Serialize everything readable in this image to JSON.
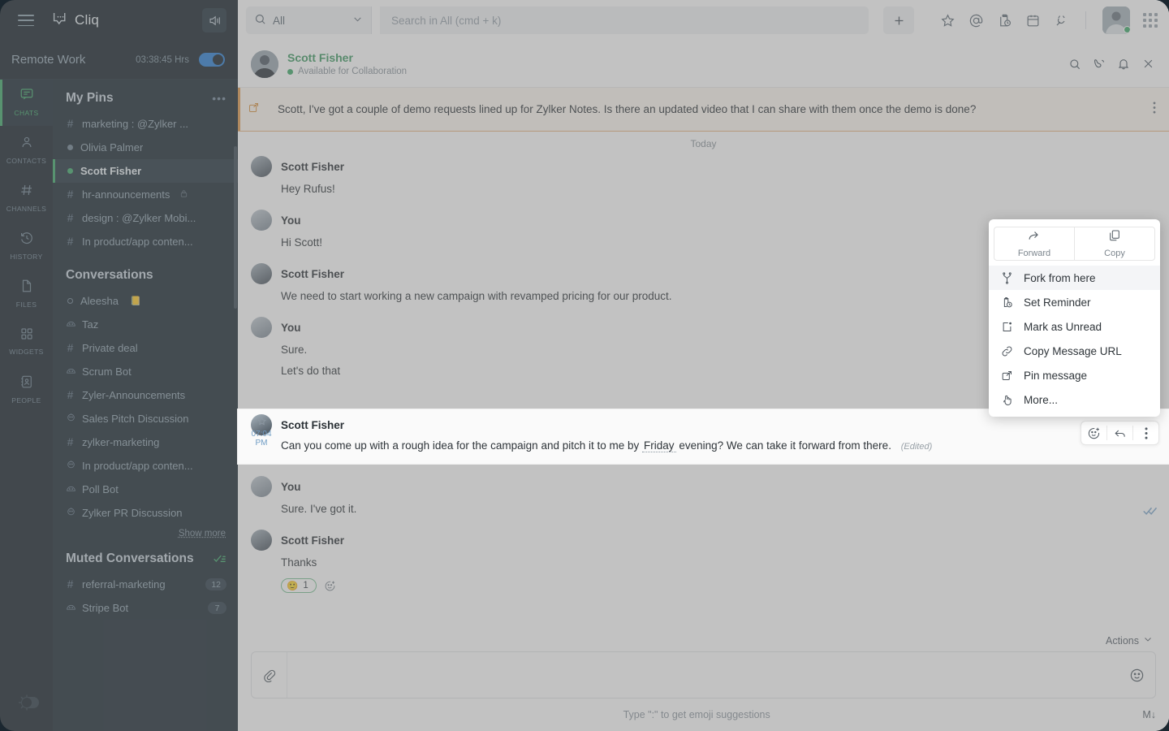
{
  "app": {
    "brand": "Cliq",
    "menu_icon": "hamburger-icon",
    "speaker_icon": "speaker-volume-icon",
    "theme_toggle_icon": "sun-theme-toggle"
  },
  "status": {
    "name": "Remote Work",
    "timer": "03:38:45 Hrs",
    "toggle_on": true
  },
  "rail": [
    {
      "label": "CHATS",
      "icon": "chat-bubble-icon",
      "active": true
    },
    {
      "label": "CONTACTS",
      "icon": "person-icon",
      "active": false
    },
    {
      "label": "CHANNELS",
      "icon": "hash-icon",
      "active": false
    },
    {
      "label": "HISTORY",
      "icon": "clock-rewind-icon",
      "active": false
    },
    {
      "label": "FILES",
      "icon": "file-icon",
      "active": false
    },
    {
      "label": "WIDGETS",
      "icon": "grid-squares-icon",
      "active": false
    },
    {
      "label": "PEOPLE",
      "icon": "contact-card-icon",
      "active": false
    }
  ],
  "sidebar": {
    "pins_title": "My Pins",
    "pins_more": "•••",
    "pins": [
      {
        "label": "marketing : @Zylker ...",
        "marker": "hash",
        "locked": false
      },
      {
        "label": "Olivia Palmer",
        "marker": "dot-grey",
        "locked": false
      },
      {
        "label": "Scott Fisher",
        "marker": "dot-green",
        "locked": false,
        "selected": true
      },
      {
        "label": "hr-announcements",
        "marker": "hash",
        "locked": true
      },
      {
        "label": "design : @Zylker Mobi...",
        "marker": "hash",
        "locked": false
      },
      {
        "label": "In product/app conten...",
        "marker": "hash",
        "locked": false
      }
    ],
    "conversations_title": "Conversations",
    "conversations": [
      {
        "label": "Aleesha",
        "marker": "dot-hollow",
        "emoji": "📒"
      },
      {
        "label": "Taz",
        "marker": "bot"
      },
      {
        "label": "Private deal",
        "marker": "hash"
      },
      {
        "label": "Scrum Bot",
        "marker": "bot"
      },
      {
        "label": "Zyler-Announcements",
        "marker": "hash"
      },
      {
        "label": "Sales Pitch Discussion",
        "marker": "group"
      },
      {
        "label": "zylker-marketing",
        "marker": "hash"
      },
      {
        "label": "In product/app conten...",
        "marker": "group"
      },
      {
        "label": "Poll Bot",
        "marker": "bot"
      },
      {
        "label": "Zylker PR Discussion",
        "marker": "group"
      }
    ],
    "show_more": "Show more",
    "muted_title": "Muted Conversations",
    "muted_action_icon": "mark-all-read-icon",
    "muted": [
      {
        "label": "referral-marketing",
        "marker": "hash",
        "count": "12"
      },
      {
        "label": "Stripe Bot",
        "marker": "bot",
        "count": "7"
      }
    ]
  },
  "search": {
    "scope_label": "All",
    "scope_icon": "search-icon",
    "placeholder": "Search in All (cmd + k)",
    "new_chat_icon": "plus-icon"
  },
  "header_icons": [
    {
      "name": "star-icon"
    },
    {
      "name": "mention-icon"
    },
    {
      "name": "reminders-icon"
    },
    {
      "name": "calendar-icon"
    },
    {
      "name": "integrations-plug-icon"
    },
    {
      "name": "apps-grid-icon"
    }
  ],
  "chat": {
    "name": "Scott Fisher",
    "status": "Available for Collaboration",
    "actions": [
      {
        "name": "search-in-chat-icon"
      },
      {
        "name": "call-icon"
      },
      {
        "name": "notification-bell-icon"
      },
      {
        "name": "close-icon"
      }
    ]
  },
  "pinned": {
    "icon": "pin-message-icon",
    "text": "Scott, I've got a couple of demo requests lined up for Zylker Notes. Is there an updated video that I can share with them once the demo is done?",
    "more_icon": "kebab-menu-icon"
  },
  "day_divider": "Today",
  "messages": [
    {
      "sender": "Scott Fisher",
      "avatar": "scott",
      "lines": [
        "Hey Rufus!"
      ]
    },
    {
      "sender": "You",
      "avatar": "you",
      "lines": [
        "Hi Scott!"
      ]
    },
    {
      "sender": "Scott Fisher",
      "avatar": "scott",
      "lines": [
        "We need to start working a new campaign with revamped pricing for our product."
      ]
    },
    {
      "sender": "You",
      "avatar": "you",
      "lines": [
        "Sure.",
        "Let's do that"
      ]
    }
  ],
  "highlighted_message": {
    "sender": "Scott Fisher",
    "time": "07:04 PM",
    "star_icon": "star-outline-icon",
    "text_before": "Can you come up with a rough idea for the campaign and pitch it to me by",
    "entity": "Friday",
    "text_after": "evening? We can take it forward from there.",
    "edited": "(Edited)",
    "hover_actions": [
      {
        "name": "add-reaction-icon"
      },
      {
        "name": "reply-icon"
      },
      {
        "name": "more-options-icon"
      }
    ]
  },
  "messages_after": [
    {
      "sender": "You",
      "avatar": "you",
      "lines": [
        "Sure. I've got it."
      ],
      "read_receipt": true
    },
    {
      "sender": "Scott Fisher",
      "avatar": "scott",
      "lines": [
        "Thanks"
      ],
      "reactions": [
        {
          "emoji": "🙂",
          "count": "1"
        }
      ],
      "add_reaction_icon": "add-reaction-icon"
    }
  ],
  "context_menu": {
    "top": [
      {
        "label": "Forward",
        "icon": "forward-arrow-icon"
      },
      {
        "label": "Copy",
        "icon": "copy-icon"
      }
    ],
    "items": [
      {
        "label": "Fork from here",
        "icon": "fork-icon",
        "highlighted": true
      },
      {
        "label": "Set Reminder",
        "icon": "reminder-clock-icon",
        "highlighted": false
      },
      {
        "label": "Mark as Unread",
        "icon": "mark-unread-icon",
        "highlighted": false
      },
      {
        "label": "Copy Message URL",
        "icon": "link-icon",
        "highlighted": false
      },
      {
        "label": "Pin message",
        "icon": "pin-icon",
        "highlighted": false
      },
      {
        "label": "More...",
        "icon": "hand-tap-icon",
        "highlighted": false
      }
    ]
  },
  "composer": {
    "actions_label": "Actions",
    "actions_chevron": "chevron-down-icon",
    "attach_icon": "paperclip-icon",
    "placeholder": "",
    "emoji_icon": "emoji-smiley-icon",
    "hint": "Type \":\" to get emoji suggestions",
    "markdown_label": "M↓"
  },
  "colors": {
    "accent_green": "#3faa6a",
    "sidebar_bg": "#1b2832",
    "rail_bg": "#16222b",
    "pin_accent": "#e09a4e",
    "toggle_blue": "#2a7fd4"
  }
}
